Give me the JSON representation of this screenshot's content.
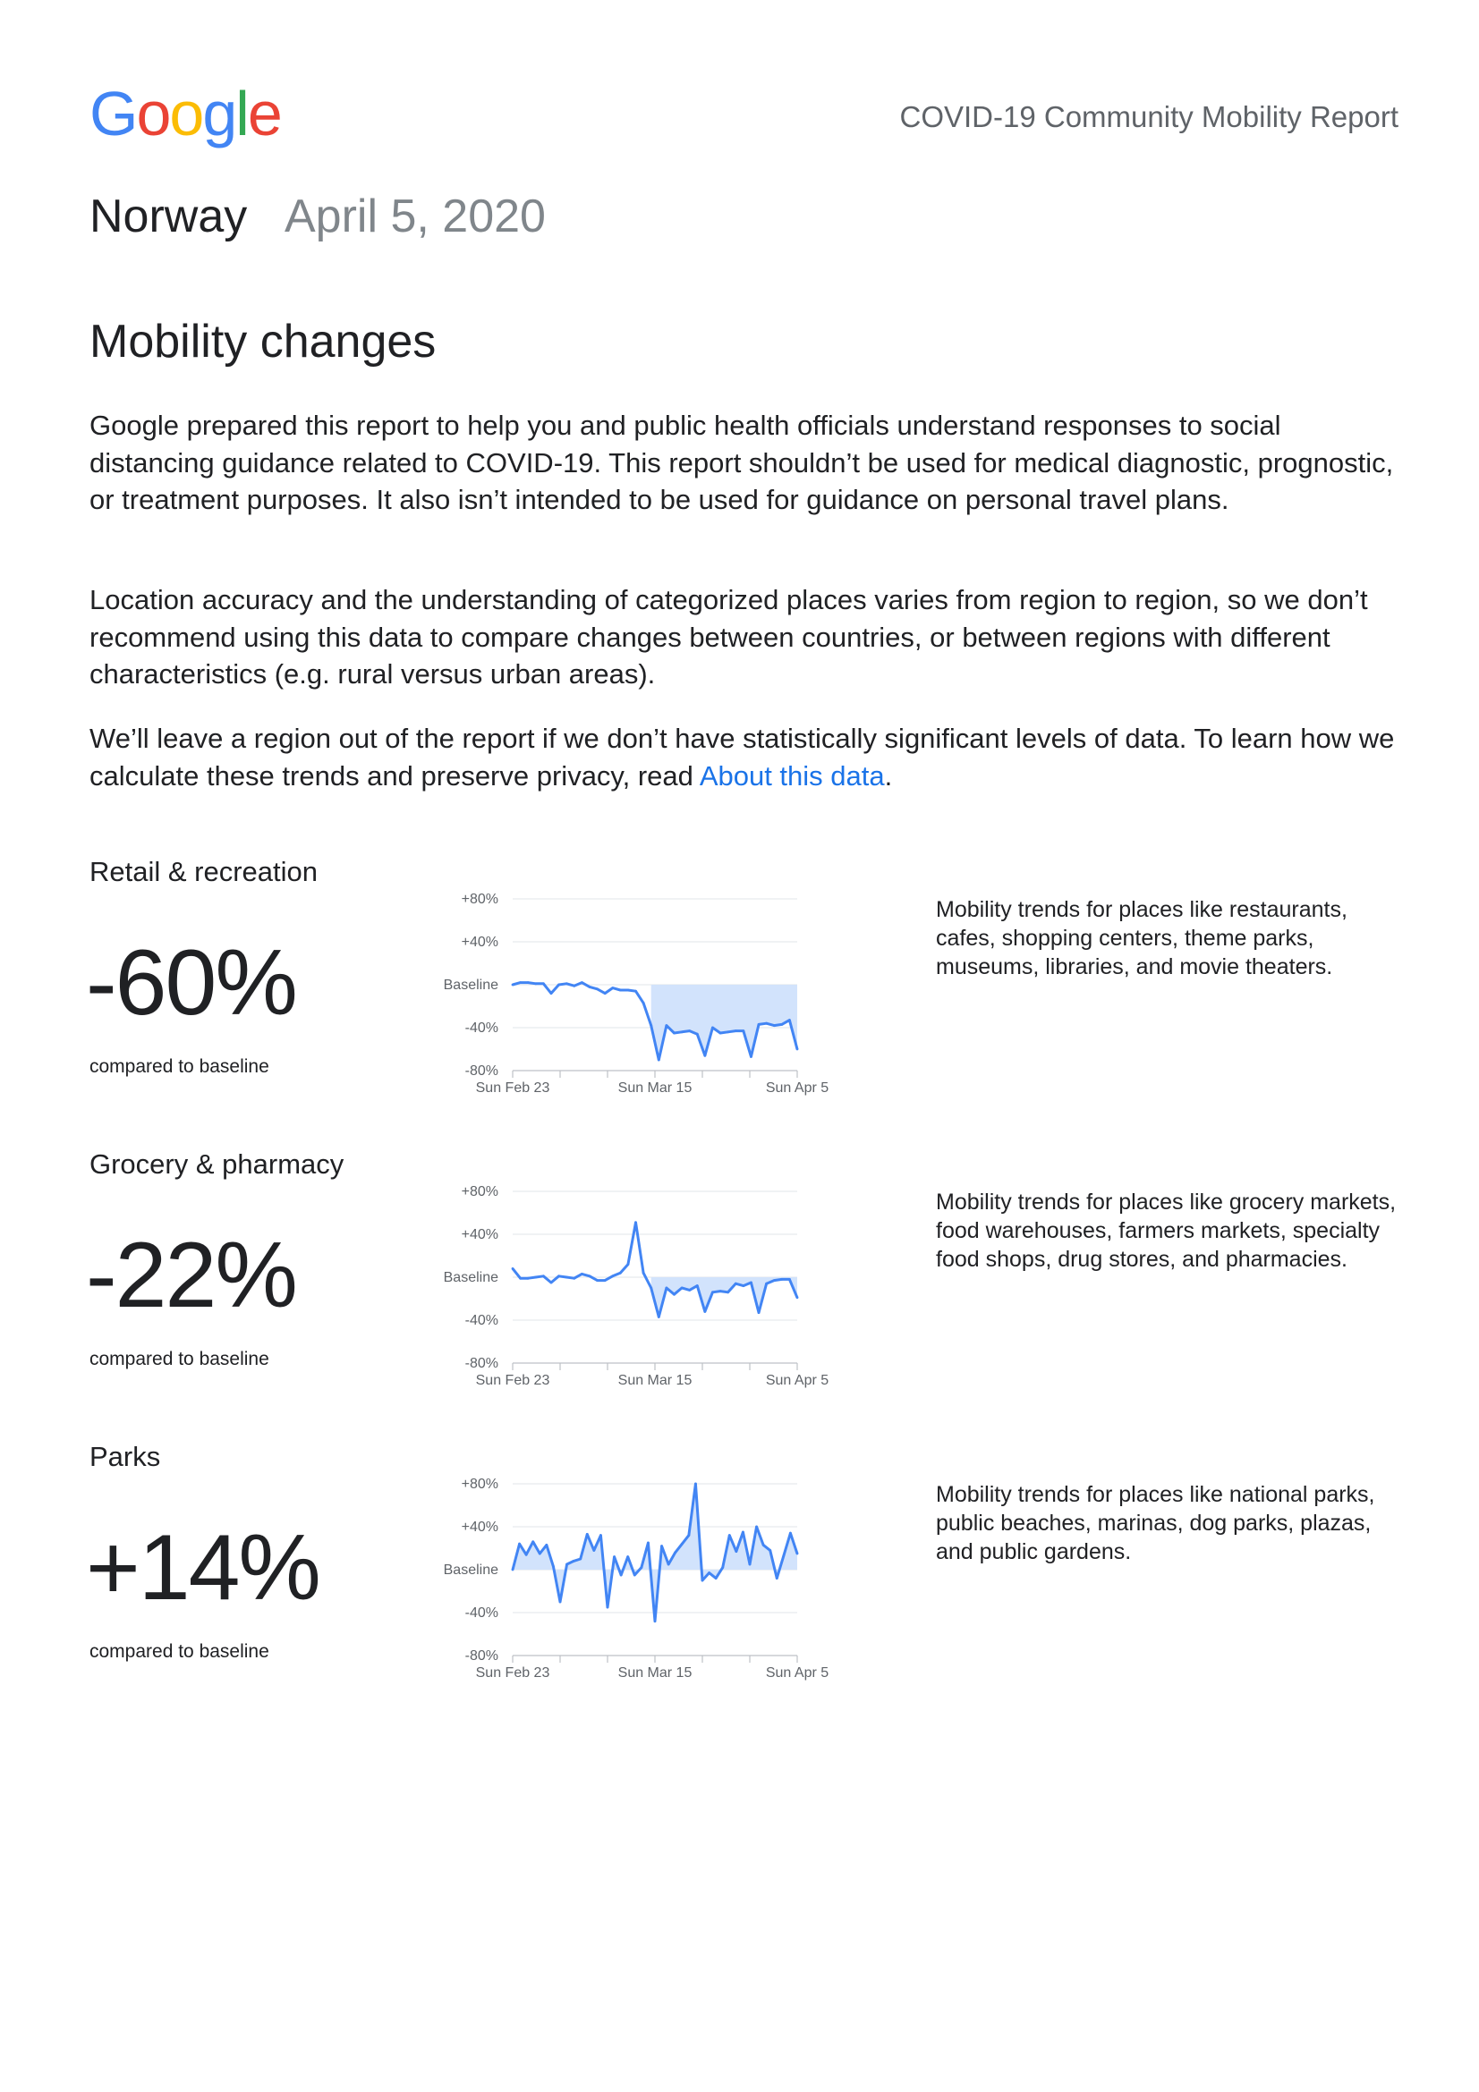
{
  "header": {
    "logo_text": "Google",
    "logo_colors": [
      "#4285F4",
      "#EA4335",
      "#FBBC05",
      "#4285F4",
      "#34A853",
      "#EA4335"
    ],
    "report_title": "COVID-19 Community Mobility Report"
  },
  "title": {
    "country": "Norway",
    "date": "April 5, 2020"
  },
  "section": {
    "heading": "Mobility changes",
    "paragraphs": [
      "Google prepared this report to help you and public health officials understand responses to social distancing guidance related to COVID-19. This report shouldn’t be used for medical diagnostic, prognostic, or treatment purposes. It also isn’t intended to be used for guidance on personal travel plans.",
      "Location accuracy and the understanding of categorized places varies from region to region, so we don’t recommend using this data to compare changes between countries, or between regions with different characteristics (e.g. rural versus urban areas)."
    ],
    "paragraph3_before": "We’ll leave a region out of the report if we don’t have statistically significant levels of data. To learn how we calculate these trends and preserve privacy, read ",
    "paragraph3_link": "About this data",
    "paragraph3_after": ".",
    "link_color": "#1a73e8"
  },
  "categories": [
    {
      "title": "Retail & recreation",
      "value": "-60%",
      "compare": "compared to baseline",
      "description": "Mobility trends for places like restaurants, cafes, shopping centers, theme parks, museums, libraries, and movie theaters."
    },
    {
      "title": "Grocery & pharmacy",
      "value": "-22%",
      "compare": "compared to baseline",
      "description": "Mobility trends for places like grocery markets, food warehouses, farmers markets, specialty food shops, drug stores, and pharmacies."
    },
    {
      "title": "Parks",
      "value": "+14%",
      "compare": "compared to baseline",
      "description": "Mobility trends for places like national parks, public beaches, marinas, dog parks, plazas, and public gardens."
    }
  ],
  "chart_data": [
    {
      "type": "line",
      "ytick_labels": [
        "+80%",
        "+40%",
        "Baseline",
        "-40%",
        "-80%"
      ],
      "yticks": [
        80,
        40,
        0,
        -40,
        -80
      ],
      "ylim": [
        -80,
        80
      ],
      "xtick_labels": [
        "Sun Feb 23",
        "Sun Mar 15",
        "Sun Apr 5"
      ],
      "xtick_index": [
        0,
        21,
        42
      ],
      "baseline_shading_from_index": 18,
      "line_color": "#4285f4",
      "fill_color": "#d2e3fc",
      "values": [
        0,
        2,
        2,
        1,
        1,
        -8,
        0,
        1,
        -1,
        2,
        -2,
        -4,
        -8,
        -3,
        -5,
        -5,
        -6,
        -17,
        -38,
        -70,
        -38,
        -45,
        -44,
        -43,
        -46,
        -66,
        -40,
        -45,
        -44,
        -43,
        -43,
        -67,
        -37,
        -36,
        -38,
        -37,
        -33,
        -60
      ]
    },
    {
      "type": "line",
      "ytick_labels": [
        "+80%",
        "+40%",
        "Baseline",
        "-40%",
        "-80%"
      ],
      "yticks": [
        80,
        40,
        0,
        -40,
        -80
      ],
      "ylim": [
        -80,
        80
      ],
      "xtick_labels": [
        "Sun Feb 23",
        "Sun Mar 15",
        "Sun Apr 5"
      ],
      "xtick_index": [
        0,
        21,
        42
      ],
      "baseline_shading_from_index": 18,
      "line_color": "#4285f4",
      "fill_color": "#d2e3fc",
      "values": [
        8,
        -1,
        -1,
        0,
        1,
        -5,
        1,
        0,
        -1,
        3,
        1,
        -3,
        -3,
        1,
        4,
        12,
        51,
        4,
        -10,
        -37,
        -10,
        -16,
        -10,
        -12,
        -8,
        -32,
        -14,
        -13,
        -14,
        -6,
        -8,
        -5,
        -33,
        -6,
        -3,
        -2,
        -2,
        -19
      ]
    },
    {
      "type": "line",
      "ytick_labels": [
        "+80%",
        "+40%",
        "Baseline",
        "-40%",
        "-80%"
      ],
      "yticks": [
        80,
        40,
        0,
        -40,
        -80
      ],
      "ylim": [
        -80,
        80
      ],
      "xtick_labels": [
        "Sun Feb 23",
        "Sun Mar 15",
        "Sun Apr 5"
      ],
      "xtick_index": [
        0,
        21,
        42
      ],
      "line_color": "#4285f4",
      "fill_color": "#d2e3fc",
      "values": [
        0,
        24,
        14,
        26,
        15,
        23,
        3,
        -30,
        5,
        8,
        10,
        33,
        18,
        32,
        -35,
        12,
        -5,
        12,
        -5,
        2,
        25,
        -48,
        22,
        5,
        16,
        24,
        32,
        80,
        -10,
        -3,
        -8,
        2,
        32,
        17,
        35,
        5,
        40,
        23,
        18,
        -8,
        13,
        34,
        15
      ]
    }
  ]
}
